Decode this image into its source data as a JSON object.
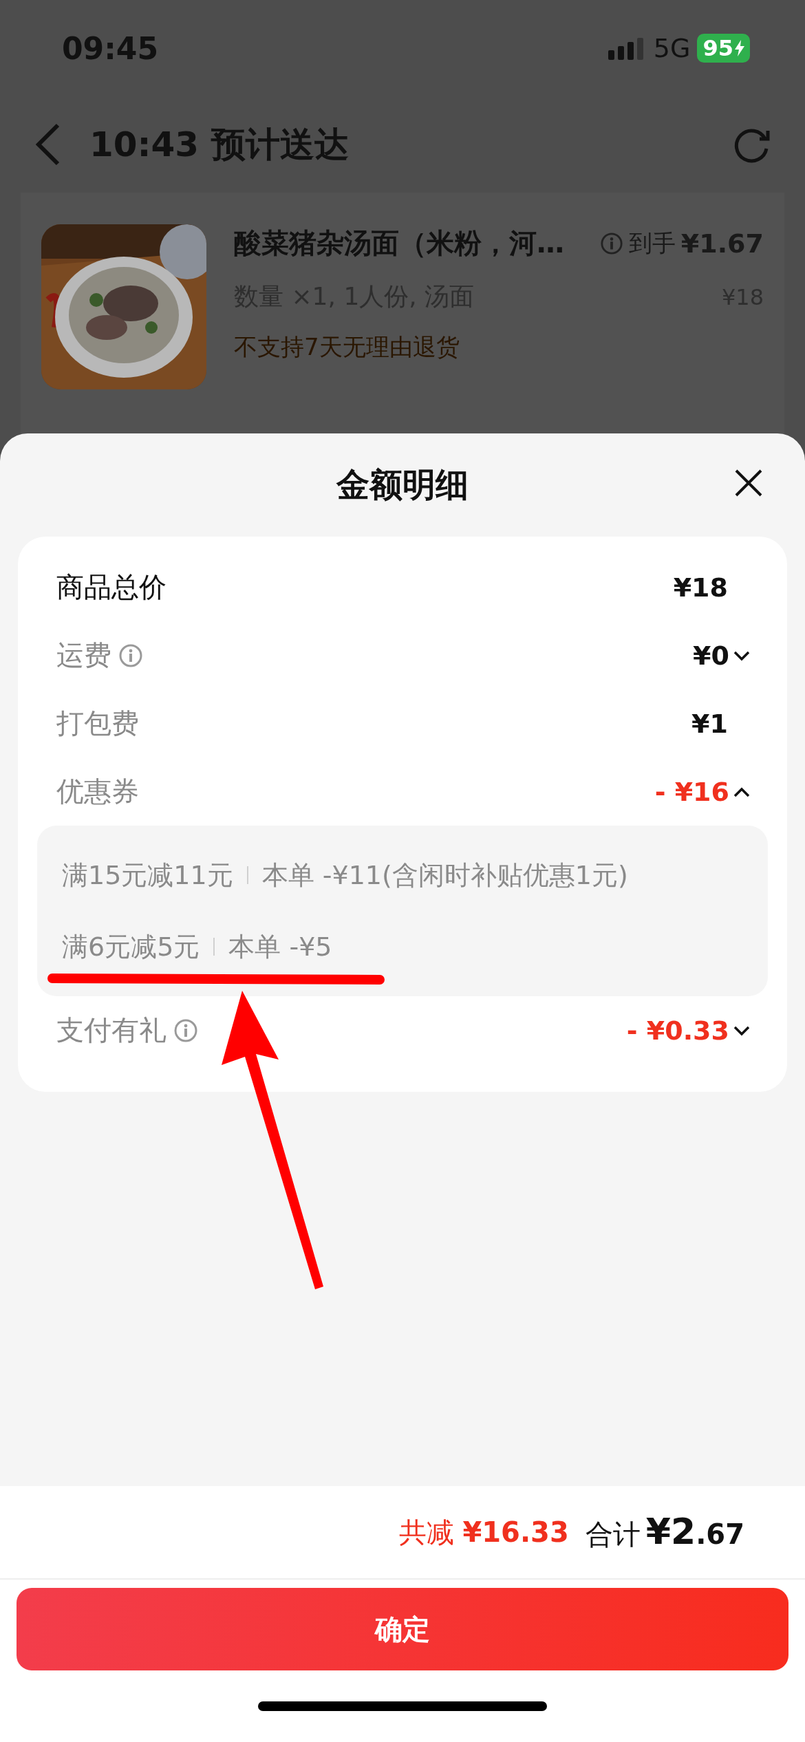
{
  "status_bar": {
    "time": "09:45",
    "network": "5G",
    "battery": "95"
  },
  "header": {
    "title": "10:43 预计送达"
  },
  "product": {
    "name": "酸菜猪杂汤面（米粉，河…",
    "spec": "数量 ×1, 1人份, 汤面",
    "notice": "不支持7天无理由退货",
    "final_price_label": "到手",
    "final_price": "¥1.67",
    "original_price": "¥18"
  },
  "sheet": {
    "title": "金额明细",
    "rows": [
      {
        "label": "商品总价",
        "value": "¥18",
        "primary": true,
        "info": false,
        "discount": false,
        "kind": "plain"
      },
      {
        "label": "运费",
        "value": "¥0",
        "primary": false,
        "info": true,
        "discount": false,
        "kind": "expandable",
        "expanded": false
      },
      {
        "label": "打包费",
        "value": "¥1",
        "primary": false,
        "info": false,
        "discount": false,
        "kind": "plain"
      },
      {
        "label": "优惠券",
        "value": "- ¥16",
        "primary": false,
        "info": false,
        "discount": true,
        "kind": "expandable",
        "expanded": true,
        "details": [
          {
            "condition": "满15元减11元",
            "amount": "本单 -¥11(含闲时补贴优惠1元)"
          },
          {
            "condition": "满6元减5元",
            "amount": "本单 -¥5"
          }
        ]
      },
      {
        "label": "支付有礼",
        "value": "- ¥0.33",
        "primary": false,
        "info": true,
        "discount": true,
        "kind": "expandable",
        "expanded": false
      }
    ]
  },
  "footer": {
    "saved_label": "共减",
    "saved": "¥16.33",
    "total_label": "合计",
    "total": "¥2.67",
    "confirm": "确定"
  },
  "annotation": {
    "kind": "underline_arrow"
  }
}
